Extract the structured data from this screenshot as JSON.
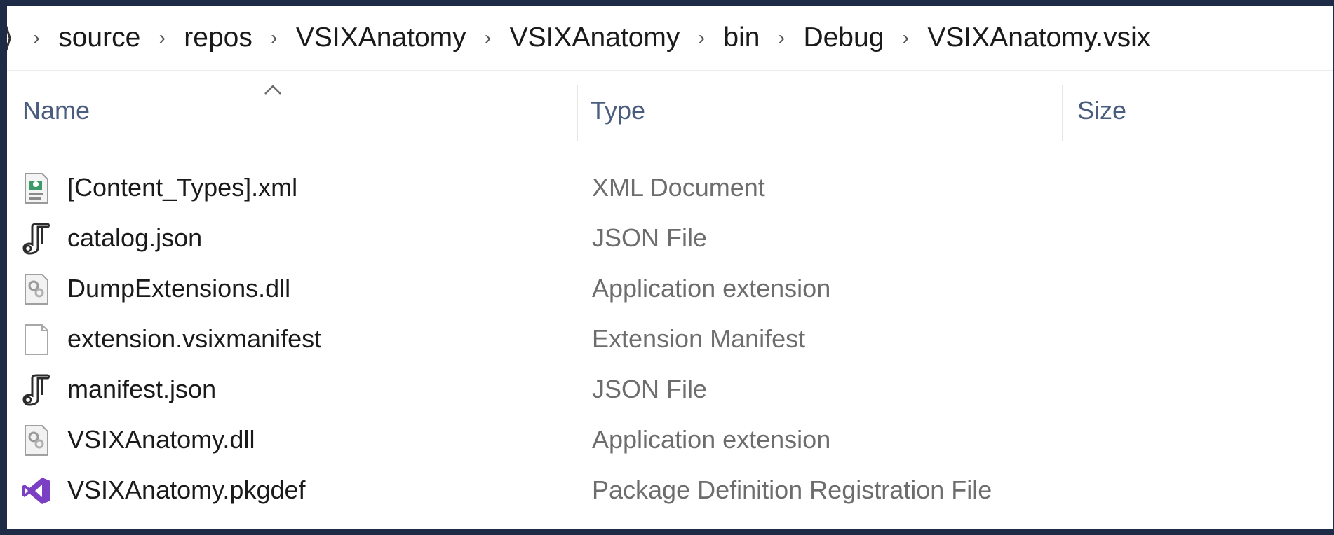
{
  "breadcrumb": {
    "segments": [
      "source",
      "repos",
      "VSIXAnatomy",
      "VSIXAnatomy",
      "bin",
      "Debug",
      "VSIXAnatomy.vsix"
    ],
    "separator": "›"
  },
  "columns": {
    "name": "Name",
    "type": "Type",
    "size": "Size",
    "sort_indicator": "^"
  },
  "files": [
    {
      "name": "[Content_Types].xml",
      "type": "XML Document",
      "icon": "xml-document-icon"
    },
    {
      "name": "catalog.json",
      "type": "JSON File",
      "icon": "json-file-icon"
    },
    {
      "name": "DumpExtensions.dll",
      "type": "Application extension",
      "icon": "dll-file-icon"
    },
    {
      "name": "extension.vsixmanifest",
      "type": "Extension Manifest",
      "icon": "blank-file-icon"
    },
    {
      "name": "manifest.json",
      "type": "JSON File",
      "icon": "json-file-icon"
    },
    {
      "name": "VSIXAnatomy.dll",
      "type": "Application extension",
      "icon": "dll-file-icon"
    },
    {
      "name": "VSIXAnatomy.pkgdef",
      "type": "Package Definition Registration File",
      "icon": "visual-studio-icon"
    }
  ],
  "colors": {
    "frame_border": "#1d2b47",
    "header_text": "#4a5d7e",
    "type_text": "#6d6d6d",
    "vs_purple": "#7b3fc4"
  }
}
